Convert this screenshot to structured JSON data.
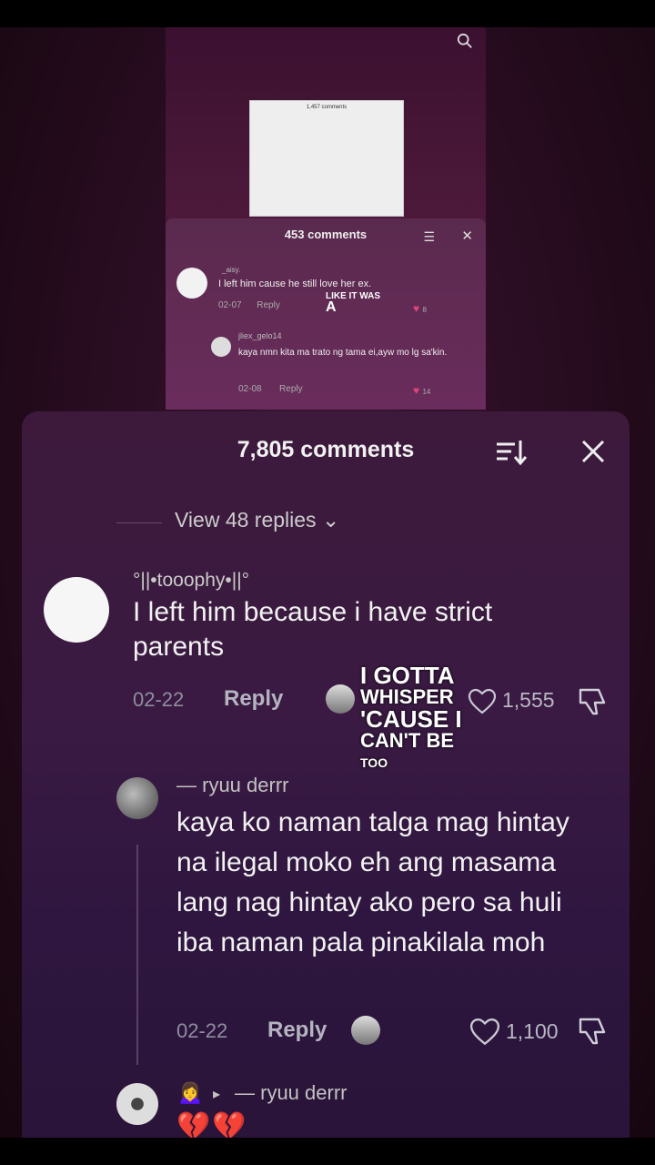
{
  "mini": {
    "panel_title": "453 comments",
    "pic_count": "1,457 comments",
    "comment": {
      "user": "_aisy.",
      "text": "I left him cause he still love her ex.",
      "date": "02-07",
      "reply": "Reply",
      "likes": "8"
    },
    "reply": {
      "user": "jliex_gelo14",
      "text": "kaya nmn kita ma trato ng tama ei,ayw mo lg sa'kin.",
      "date": "02-08",
      "reply": "Reply",
      "likes": "14"
    },
    "overlay_line1": "LIKE IT WAS",
    "overlay_line2": "A"
  },
  "panel": {
    "title": "7,805 comments",
    "view_replies": "View 48 replies ⌄"
  },
  "comment_main": {
    "user": "°||•tooophy•||°",
    "text": "I left him because i have strict parents",
    "date": "02-22",
    "reply": "Reply",
    "likes": "1,555"
  },
  "lyric_overlay": {
    "line1": "I GOTTA",
    "line2": "WHISPER",
    "line3": "'CAUSE I",
    "line4": "CAN'T BE",
    "line5": "TOO"
  },
  "reply1": {
    "user": "— ryuu derrr",
    "text": "kaya ko naman talga mag hintay na ilegal moko eh ang masama lang nag hintay ako pero sa huli iba naman pala pinakilala moh",
    "date": "02-22",
    "reply": "Reply",
    "likes": "1,100"
  },
  "reply2": {
    "emoji": "🙍‍♀️",
    "arrow": "▸",
    "user": "— ryuu derrr",
    "text": "💔💔"
  },
  "colors": {
    "accent_heart": "#e0457b",
    "broken_heart": "#d8344f"
  }
}
